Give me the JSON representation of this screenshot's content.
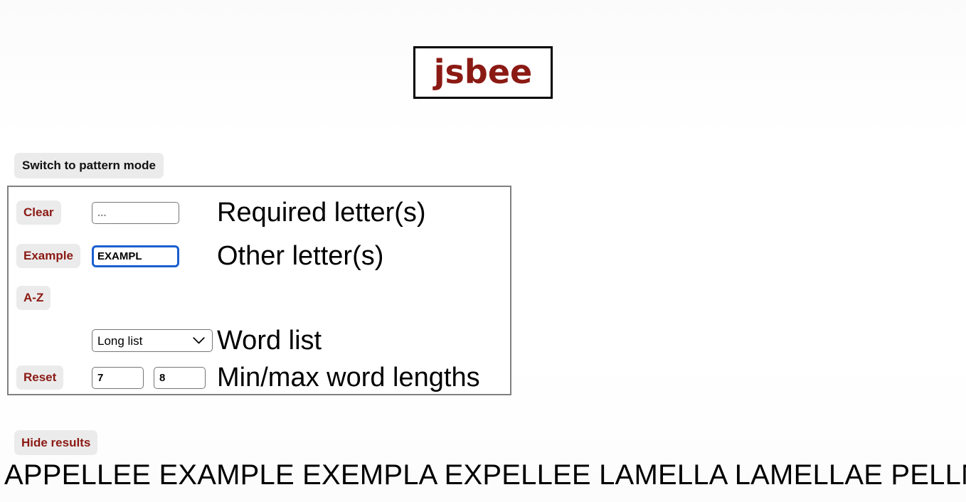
{
  "app": {
    "title": "jsbee",
    "title_color": "#8b1a14",
    "accent_color": "#8b1a14",
    "focus_color": "#1a5fd0",
    "button_bg": "#ebebeb"
  },
  "mode_switch": {
    "label": "Switch to pattern mode"
  },
  "form": {
    "rows": [
      {
        "button": "Clear",
        "input_value": "",
        "input_placeholder": "...",
        "label": "Required letter(s)"
      },
      {
        "button": "Example",
        "input_value": "EXAMPL",
        "input_placeholder": "",
        "label": "Other letter(s)"
      },
      {
        "button": "A-Z",
        "label": ""
      },
      {
        "button": "",
        "select_value": "Long list",
        "select_options": [
          "Long list"
        ],
        "label": "Word list"
      },
      {
        "button": "Reset",
        "min_value": "7",
        "max_value": "8",
        "label": "Min/max word lengths"
      }
    ]
  },
  "results": {
    "toggle_label": "Hide results",
    "words": [
      "APPELLEE",
      "EXAMPLE",
      "EXEMPLA",
      "EXPELLEE",
      "LAMELLA",
      "LAMELLAE",
      "PELLMELL"
    ],
    "text": "APPELLEE EXAMPLE EXEMPLA EXPELLEE LAMELLA LAMELLAE PELLMELL"
  },
  "icons": {
    "chevron_down": "chevron-down-icon"
  }
}
